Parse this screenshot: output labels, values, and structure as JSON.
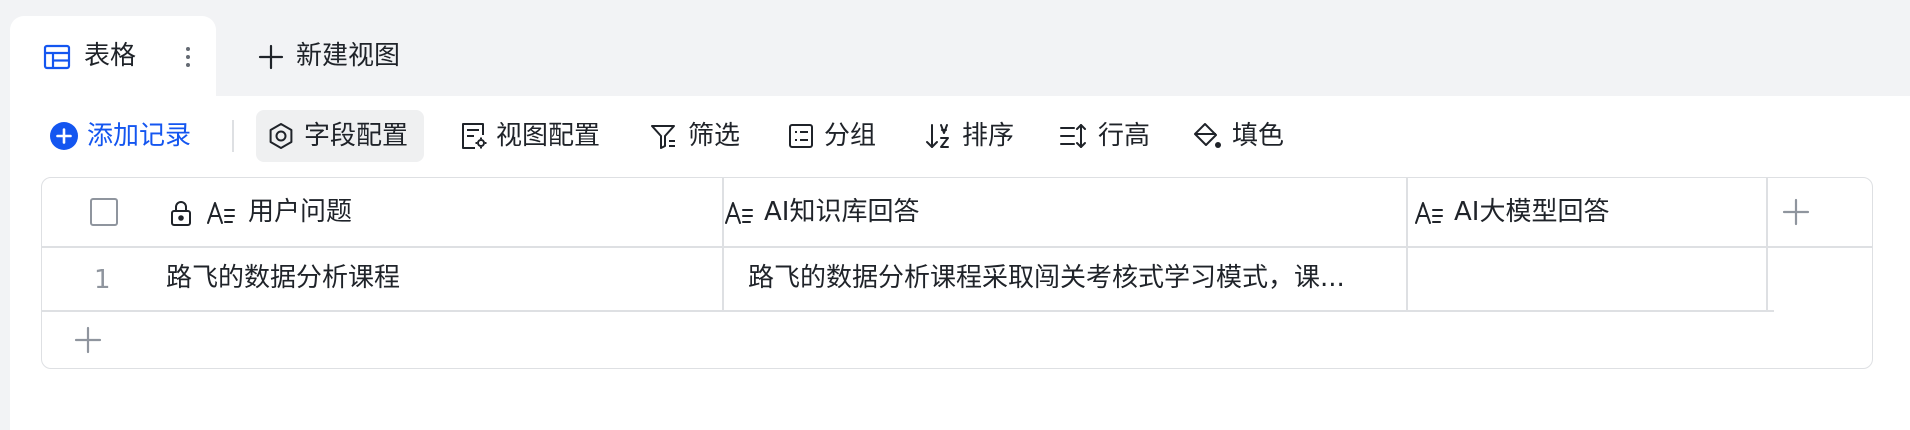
{
  "tabs": {
    "active": {
      "label": "表格",
      "icon": "table-icon",
      "more_icon": "more-vertical-icon"
    },
    "new_view": {
      "label": "新建视图",
      "icon": "plus-icon"
    }
  },
  "toolbar": {
    "add_record": "添加记录",
    "field_config": "字段配置",
    "view_config": "视图配置",
    "filter": "筛选",
    "group": "分组",
    "sort": "排序",
    "row_height": "行高",
    "fill_color": "填色"
  },
  "grid": {
    "columns": [
      {
        "label": "用户问题",
        "locked": true,
        "type_icon": "text-field-icon"
      },
      {
        "label": "AI知识库回答",
        "locked": false,
        "type_icon": "text-field-icon"
      },
      {
        "label": "AI大模型回答",
        "locked": false,
        "type_icon": "text-field-icon"
      }
    ],
    "rows": [
      {
        "index": "1",
        "cells": [
          "路飞的数据分析课程",
          "路飞的数据分析课程采取闯关考核式学习模式，课...",
          ""
        ]
      }
    ]
  },
  "colors": {
    "accent": "#1456f0",
    "text": "#1f2329",
    "border": "#dee0e3",
    "muted": "#8f959e",
    "tab_strip_bg": "#f2f3f5",
    "active_button_bg": "#eff0f1"
  }
}
